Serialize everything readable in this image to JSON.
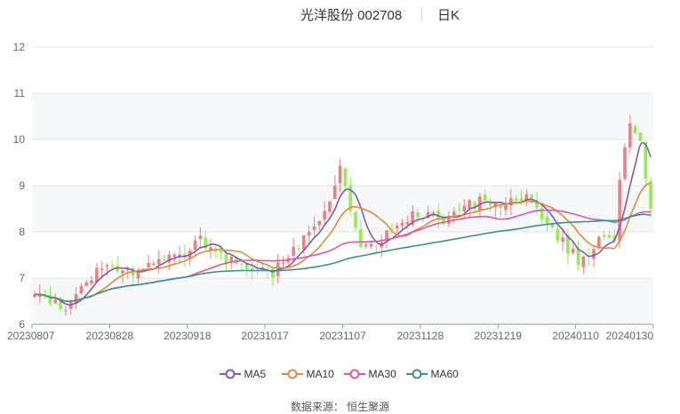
{
  "header": {
    "title": "光洋股份 002708",
    "period": "日K"
  },
  "source": "数据来源：  恒生聚源",
  "chart_data": {
    "type": "candlestick",
    "ylim": [
      6,
      12
    ],
    "yticks": [
      6,
      7,
      8,
      9,
      10,
      11,
      12
    ],
    "grid": true,
    "legend_position": "bottom",
    "x_tick_labels": [
      "20230807",
      "20230828",
      "20230918",
      "20231017",
      "20231107",
      "20231128",
      "20231219",
      "20240110",
      "20240130"
    ],
    "up_color": "#f08080",
    "down_color": "#90ee50",
    "series": [
      {
        "name": "MA5",
        "color": "#7b5ab5",
        "period": 5
      },
      {
        "name": "MA10",
        "color": "#e08a3c",
        "period": 10
      },
      {
        "name": "MA30",
        "color": "#d659b0",
        "period": 30
      },
      {
        "name": "MA60",
        "color": "#3f8f8a",
        "period": 60
      }
    ],
    "candles_note": "illustrative values"
  }
}
